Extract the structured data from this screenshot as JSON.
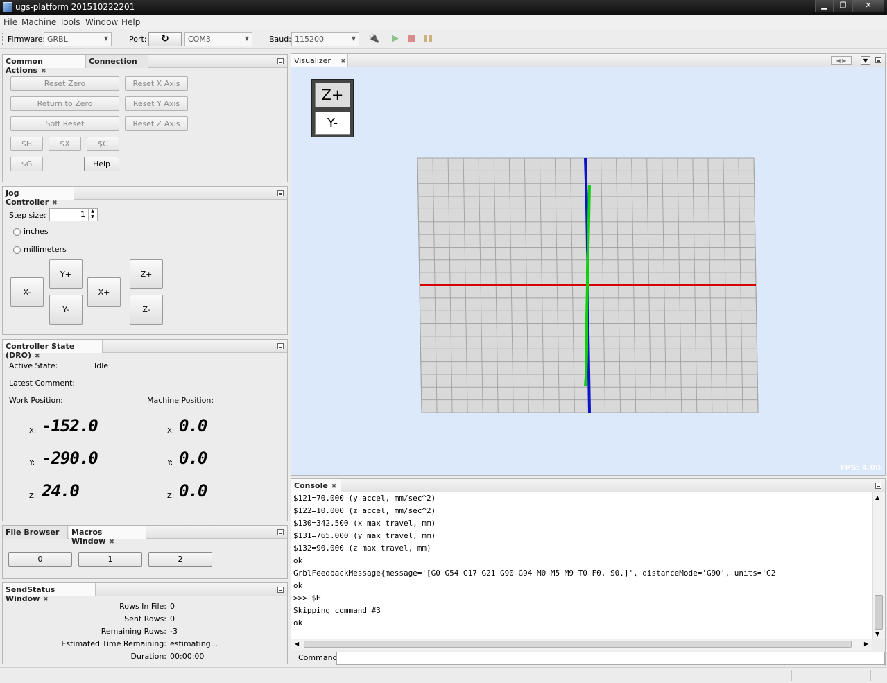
{
  "window": {
    "title": "ugs-platform 201510222201"
  },
  "menu": [
    "File",
    "Machine",
    "Tools",
    "Window",
    "Help"
  ],
  "toolbar": {
    "firmware_label": "Firmware:",
    "firmware_value": "GRBL",
    "port_label": "Port:",
    "port_value": "COM3",
    "baud_label": "Baud:",
    "baud_value": "115200"
  },
  "common_actions": {
    "tab_active": "Common Actions",
    "tab_inactive": "Connection",
    "buttons": {
      "reset_zero": "Reset Zero",
      "return_to_zero": "Return to Zero",
      "soft_reset": "Soft Reset",
      "reset_x": "Reset X Axis",
      "reset_y": "Reset Y Axis",
      "reset_z": "Reset Z Axis",
      "h": "$H",
      "x": "$X",
      "c": "$C",
      "g": "$G",
      "help": "Help"
    }
  },
  "jog": {
    "tab": "Jog Controller",
    "step_label": "Step size:",
    "step_value": "1",
    "inches": "inches",
    "millimeters": "millimeters",
    "xminus": "X-",
    "xplus": "X+",
    "yplus": "Y+",
    "yminus": "Y-",
    "zplus": "Z+",
    "zminus": "Z-"
  },
  "dro": {
    "tab": "Controller State (DRO)",
    "active_state_label": "Active State:",
    "active_state_value": "Idle",
    "latest_comment_label": "Latest Comment:",
    "work_label": "Work Position:",
    "machine_label": "Machine Position:",
    "axis_x": "X:",
    "axis_y": "Y:",
    "axis_z": "Z:",
    "work_x": "-152.0",
    "work_y": "-290.0",
    "work_z": "24.0",
    "machine_x": "0.0",
    "machine_y": "0.0",
    "machine_z": "0.0"
  },
  "macros": {
    "tab_inactive": "File Browser",
    "tab_active": "Macros Window",
    "buttons": [
      "0",
      "1",
      "2"
    ]
  },
  "sendstatus": {
    "tab": "SendStatus Window",
    "rows_in_file_label": "Rows In File:",
    "rows_in_file": "0",
    "sent_rows_label": "Sent Rows:",
    "sent_rows": "0",
    "remaining_rows_label": "Remaining Rows:",
    "remaining_rows": "-3",
    "est_time_label": "Estimated Time Remaining:",
    "est_time": "estimating...",
    "duration_label": "Duration:",
    "duration": "00:00:00"
  },
  "visualizer": {
    "tab": "Visualizer",
    "view_z": "Z+",
    "view_y": "Y-",
    "fps": "FPS: 4.00",
    "colors": {
      "background": "#dbe9fb",
      "x_axis": "#d40000",
      "y_axis": "#0a14c8",
      "toolpath": "#10d010",
      "grid": "#9a9a9a"
    }
  },
  "console": {
    "tab": "Console",
    "lines": [
      "$121=70.000 (y accel, mm/sec^2)",
      "$122=10.000 (z accel, mm/sec^2)",
      "$130=342.500 (x max travel, mm)",
      "$131=765.000 (y max travel, mm)",
      "$132=90.000 (z max travel, mm)",
      "ok",
      "GrblFeedbackMessage{message='[G0 G54 G17 G21 G90 G94 M0 M5 M9 T0 F0. S0.]', distanceMode='G90', units='G2",
      "ok",
      ">>> $H",
      "Skipping command #3",
      "ok"
    ],
    "command_label": "Command:"
  }
}
